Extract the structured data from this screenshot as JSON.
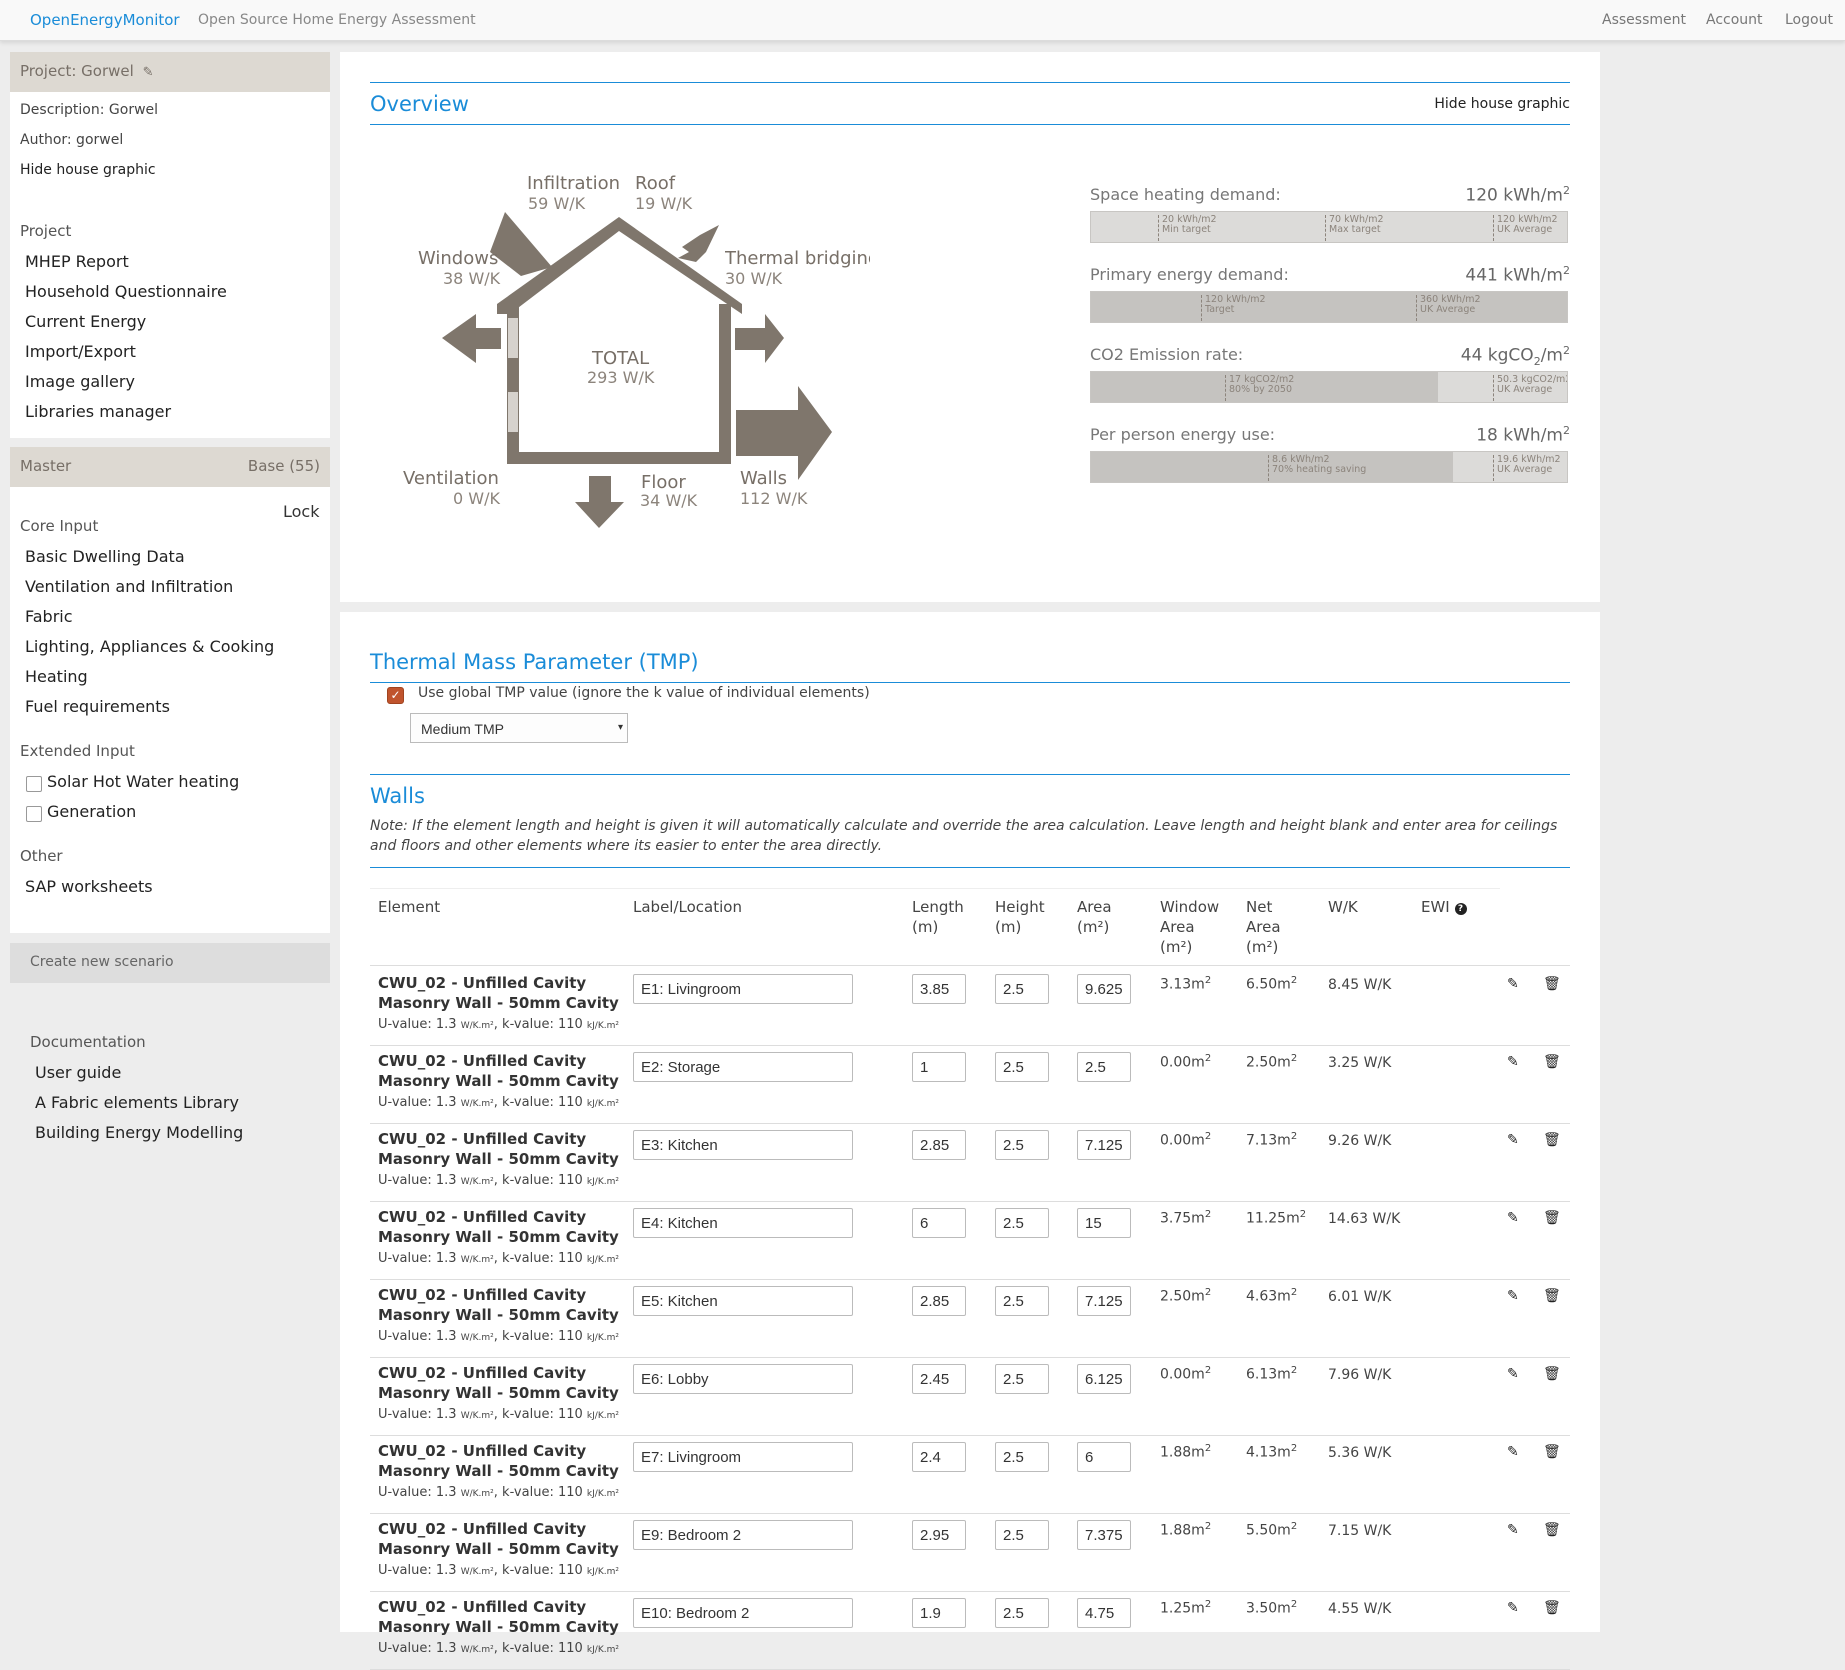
{
  "nav": {
    "brand": "OpenEnergyMonitor",
    "tagline": "Open Source Home Energy Assessment",
    "links": [
      "Assessment",
      "Account",
      "Logout"
    ]
  },
  "sidebar": {
    "project_title": "Project: Gorwel",
    "description": "Description: Gorwel",
    "author": "Author: gorwel",
    "hide_graphic": "Hide house graphic",
    "project_section": "Project",
    "project_links": [
      "MHEP Report",
      "Household Questionnaire",
      "Current Energy",
      "Import/Export",
      "Image gallery",
      "Libraries manager"
    ],
    "master_label": "Master",
    "master_base": "Base (55)",
    "lock": "Lock",
    "core_section": "Core Input",
    "core_links": [
      "Basic Dwelling Data",
      "Ventilation and Infiltration",
      "Fabric",
      "Lighting, Appliances & Cooking",
      "Heating",
      "Fuel requirements"
    ],
    "extended_section": "Extended Input",
    "extended_items": [
      "Solar Hot Water heating",
      "Generation"
    ],
    "other_section": "Other",
    "other_links": [
      "SAP worksheets"
    ],
    "create_scenario": "Create new scenario",
    "doc_section": "Documentation",
    "doc_links": [
      "User guide",
      "A Fabric elements Library",
      "Building Energy Modelling"
    ]
  },
  "overview": {
    "title": "Overview",
    "hide_graphic": "Hide house graphic",
    "house": {
      "infiltration": {
        "label": "Infiltration",
        "value": "59 W/K"
      },
      "roof": {
        "label": "Roof",
        "value": "19 W/K"
      },
      "windows": {
        "label": "Windows",
        "value": "38 W/K"
      },
      "thermal_bridging": {
        "label": "Thermal bridging",
        "value": "30 W/K"
      },
      "total": {
        "label": "TOTAL",
        "value": "293 W/K"
      },
      "ventilation": {
        "label": "Ventilation",
        "value": "0 W/K"
      },
      "floor": {
        "label": "Floor",
        "value": "34 W/K"
      },
      "walls": {
        "label": "Walls",
        "value": "112 W/K"
      }
    },
    "stats": [
      {
        "label": "Space heating demand:",
        "value": "120 kWh/m",
        "sup": "2",
        "fill_fraction": 0.0,
        "markers": [
          {
            "pos": 0.14,
            "l1": "20 kWh/m<sup>2</sup>",
            "l2": "Min target"
          },
          {
            "pos": 0.49,
            "l1": "70 kWh/m<sup>2</sup>",
            "l2": "Max target"
          },
          {
            "pos": 0.84,
            "l1": "120 kWh/m<sup>2</sup>",
            "l2": "UK Average"
          }
        ]
      },
      {
        "label": "Primary energy demand:",
        "value": "441 kWh/m",
        "sup": "2",
        "fill_fraction": 1.0,
        "markers": [
          {
            "pos": 0.23,
            "l1": "120 kWh/m<sup>2</sup>",
            "l2": "Target"
          },
          {
            "pos": 0.68,
            "l1": "360 kWh/m<sup>2</sup>",
            "l2": "UK Average"
          }
        ]
      },
      {
        "label": "CO2 Emission rate:",
        "value": "44 kgCO",
        "sub": "2",
        "value_tail": "/m",
        "sup": "2",
        "fill_fraction": 0.73,
        "markers": [
          {
            "pos": 0.28,
            "l1": "17 kgCO<sub>2</sub>/m<sup>2</sup>",
            "l2": "80% by 2050"
          },
          {
            "pos": 0.84,
            "l1": "50.3 kgCO<sub>2</sub>/m<sup>2</sup>",
            "l2": "UK Average"
          }
        ]
      },
      {
        "label": "Per person energy use:",
        "value": "18 kWh/m",
        "sup": "2",
        "fill_fraction": 0.76,
        "markers": [
          {
            "pos": 0.37,
            "l1": "8.6 kWh/m<sup>2</sup>",
            "l2": "70% heating saving"
          },
          {
            "pos": 0.84,
            "l1": "19.6 kWh/m<sup>2</sup>",
            "l2": "UK Average"
          }
        ]
      }
    ]
  },
  "tmp": {
    "title": "Thermal Mass Parameter (TMP)",
    "checkbox_label": "Use global TMP value (ignore the k value of individual elements)",
    "checked": true,
    "selected": "Medium TMP"
  },
  "walls": {
    "title": "Walls",
    "note": "Note: If the element length and height is given it will automatically calculate and override the area calculation. Leave length and height blank and enter area for ceilings and floors and other elements where its easier to enter the area directly.",
    "headers": {
      "element": "Element",
      "label": "Label/Location",
      "length": [
        "Length",
        "(m)"
      ],
      "height": [
        "Height",
        "(m)"
      ],
      "area": [
        "Area",
        "(m²)"
      ],
      "window_area": [
        "Window",
        "Area",
        "(m²)"
      ],
      "net_area": [
        "Net",
        "Area",
        "(m²)"
      ],
      "wk": "W/K",
      "ewi": "EWI"
    },
    "rows": [
      {
        "name1": "CWU_02 - Unfilled Cavity",
        "name2": "Masonry Wall - 50mm Cavity",
        "u": "1.3",
        "k": "110",
        "label": "E1: Livingroom",
        "length": "3.85",
        "height": "2.5",
        "area": "9.625",
        "window": "3.13m",
        "net": "6.50m",
        "wk": "8.45 W/K"
      },
      {
        "name1": "CWU_02 - Unfilled Cavity",
        "name2": "Masonry Wall - 50mm Cavity",
        "u": "1.3",
        "k": "110",
        "label": "E2: Storage",
        "length": "1",
        "height": "2.5",
        "area": "2.5",
        "window": "0.00m",
        "net": "2.50m",
        "wk": "3.25 W/K"
      },
      {
        "name1": "CWU_02 - Unfilled Cavity",
        "name2": "Masonry Wall - 50mm Cavity",
        "u": "1.3",
        "k": "110",
        "label": "E3: Kitchen",
        "length": "2.85",
        "height": "2.5",
        "area": "7.125",
        "window": "0.00m",
        "net": "7.13m",
        "wk": "9.26 W/K"
      },
      {
        "name1": "CWU_02 - Unfilled Cavity",
        "name2": "Masonry Wall - 50mm Cavity",
        "u": "1.3",
        "k": "110",
        "label": "E4: Kitchen",
        "length": "6",
        "height": "2.5",
        "area": "15",
        "window": "3.75m",
        "net": "11.25m",
        "wk": "14.63 W/K"
      },
      {
        "name1": "CWU_02 - Unfilled Cavity",
        "name2": "Masonry Wall - 50mm Cavity",
        "u": "1.3",
        "k": "110",
        "label": "E5: Kitchen",
        "length": "2.85",
        "height": "2.5",
        "area": "7.125",
        "window": "2.50m",
        "net": "4.63m",
        "wk": "6.01 W/K"
      },
      {
        "name1": "CWU_02 - Unfilled Cavity",
        "name2": "Masonry Wall - 50mm Cavity",
        "u": "1.3",
        "k": "110",
        "label": "E6: Lobby",
        "length": "2.45",
        "height": "2.5",
        "area": "6.125",
        "window": "0.00m",
        "net": "6.13m",
        "wk": "7.96 W/K"
      },
      {
        "name1": "CWU_02 - Unfilled Cavity",
        "name2": "Masonry Wall - 50mm Cavity",
        "u": "1.3",
        "k": "110",
        "label": "E7: Livingroom",
        "length": "2.4",
        "height": "2.5",
        "area": "6",
        "window": "1.88m",
        "net": "4.13m",
        "wk": "5.36 W/K"
      },
      {
        "name1": "CWU_02 - Unfilled Cavity",
        "name2": "Masonry Wall - 50mm Cavity",
        "u": "1.3",
        "k": "110",
        "label": "E9: Bedroom 2",
        "length": "2.95",
        "height": "2.5",
        "area": "7.375",
        "window": "1.88m",
        "net": "5.50m",
        "wk": "7.15 W/K"
      },
      {
        "name1": "CWU_02 - Unfilled Cavity",
        "name2": "Masonry Wall - 50mm Cavity",
        "u": "1.3",
        "k": "110",
        "label": "E10: Bedroom 2",
        "length": "1.9",
        "height": "2.5",
        "area": "4.75",
        "window": "1.25m",
        "net": "3.50m",
        "wk": "4.55 W/K"
      }
    ]
  }
}
